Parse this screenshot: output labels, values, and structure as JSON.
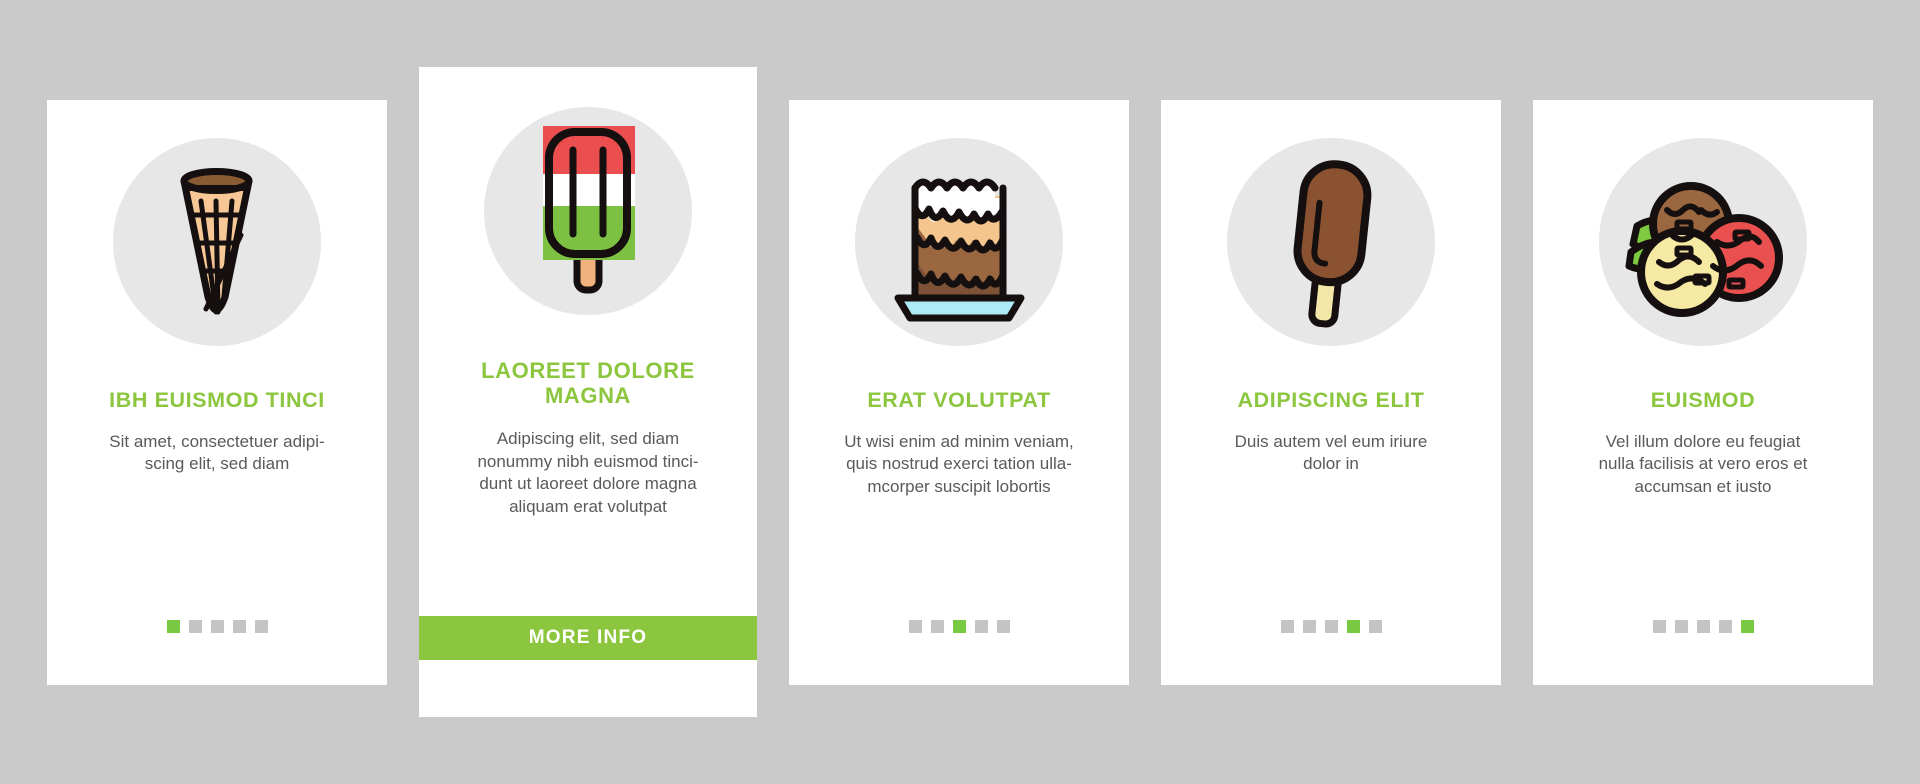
{
  "theme": {
    "background": "#cacaca",
    "card_background": "#ffffff",
    "circle_background": "#e7e7e7",
    "accent_green": "#8cc63f",
    "dot_active": "#7ac943",
    "dot_inactive": "#c4c4c4",
    "body_text": "#595a5c"
  },
  "cards": [
    {
      "icon": "ice-cream-waffle-cone-icon",
      "title": "IBH EUISMOD TINCI",
      "description": "Sit amet, consectetuer adipi-\nscing elit, sed diam",
      "featured": false,
      "pagination": {
        "total": 5,
        "active_index": 1
      }
    },
    {
      "icon": "tricolor-popsicle-icon",
      "title": "LAOREET DOLORE\nMAGNA",
      "description": "Adipiscing elit, sed diam\nnonummy nibh euismod tinci-\ndunt ut laoreet dolore magna\naliquam erat volutpat",
      "featured": true,
      "cta_label": "MORE INFO"
    },
    {
      "icon": "layer-cake-icon",
      "title": "ERAT VOLUTPAT",
      "description": "Ut wisi enim ad minim veniam,\nquis nostrud exerci tation ulla-\nmcorper suscipit lobortis",
      "featured": false,
      "pagination": {
        "total": 5,
        "active_index": 3
      }
    },
    {
      "icon": "chocolate-ice-cream-bar-icon",
      "title": "ADIPISCING ELIT",
      "description": "Duis autem vel eum iriure\ndolor in",
      "featured": false,
      "pagination": {
        "total": 5,
        "active_index": 4
      }
    },
    {
      "icon": "ice-cream-scoops-icon",
      "title": "EUISMOD",
      "description": "Vel illum dolore eu feugiat\nnulla facilisis at vero eros et\naccumsan et iusto",
      "featured": false,
      "pagination": {
        "total": 5,
        "active_index": 5
      }
    }
  ]
}
